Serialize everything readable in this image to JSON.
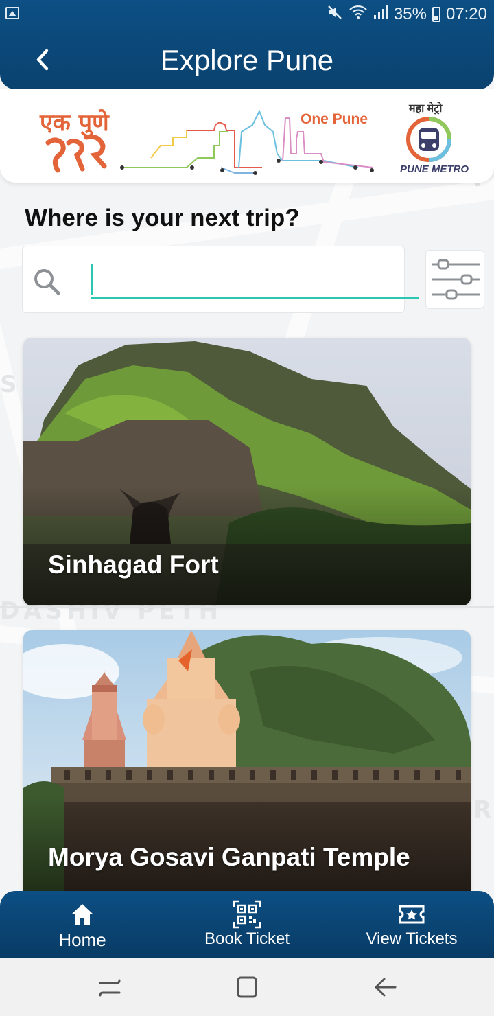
{
  "status_bar": {
    "battery": "35%",
    "time": "07:20",
    "icons": [
      "gallery-icon",
      "mute-icon",
      "wifi-icon",
      "signal-icon",
      "battery-icon"
    ]
  },
  "header": {
    "title": "Explore Pune",
    "back_icon": "chevron-left-icon"
  },
  "banner": {
    "ek_pune_logo": "एक पुणे",
    "one_pune_text": "One Pune",
    "metro_hindi": "महा मेट्रो",
    "metro_label": "PUNE METRO"
  },
  "search": {
    "question": "Where is your next trip?",
    "value": "",
    "placeholder": "",
    "filter_icon": "sliders-icon"
  },
  "places": [
    {
      "name": "Sinhagad Fort"
    },
    {
      "name": "Morya Gosavi Ganpati Temple"
    }
  ],
  "bottom_nav": {
    "items": [
      {
        "label": "Home",
        "icon": "home-icon"
      },
      {
        "label": "Book Ticket",
        "icon": "qr-code-icon"
      },
      {
        "label": "View Tickets",
        "icon": "ticket-icon"
      }
    ]
  },
  "colors": {
    "header": "#0a426f",
    "accent": "#2bc7b3",
    "one_pune_orange": "#e4643a"
  }
}
